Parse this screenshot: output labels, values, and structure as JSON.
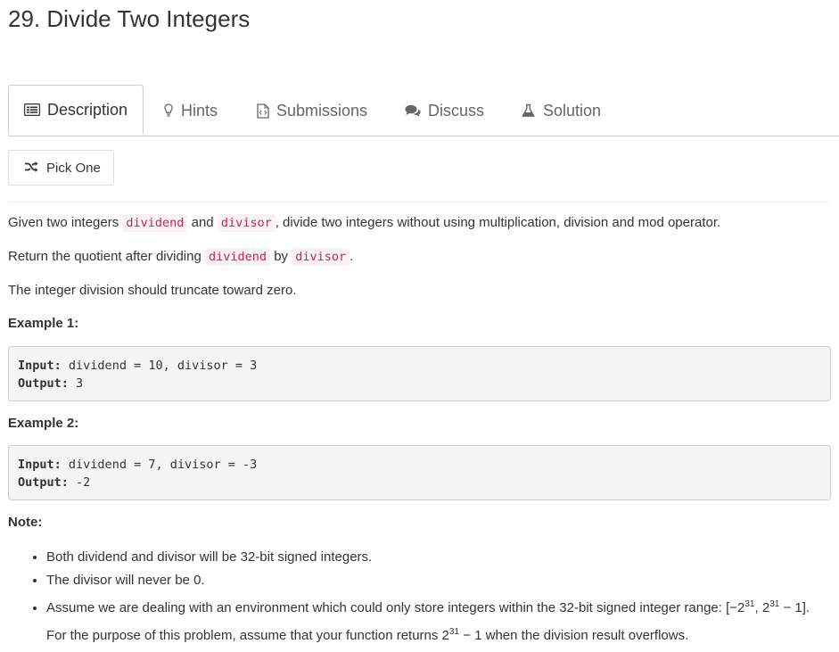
{
  "problem": {
    "title": "29. Divide Two Integers"
  },
  "tabs": [
    {
      "label": "Description",
      "icon": "description-icon",
      "active": true
    },
    {
      "label": "Hints",
      "icon": "lightbulb-icon",
      "active": false
    },
    {
      "label": "Submissions",
      "icon": "code-file-icon",
      "active": false
    },
    {
      "label": "Discuss",
      "icon": "comments-icon",
      "active": false
    },
    {
      "label": "Solution",
      "icon": "flask-icon",
      "active": false
    }
  ],
  "pick_one": {
    "label": "Pick One",
    "icon": "shuffle-icon"
  },
  "description": {
    "p1_a": "Given two integers",
    "p1_code1": "dividend",
    "p1_b": "and",
    "p1_code2": "divisor",
    "p1_c": ", divide two integers without using multiplication, division and mod operator.",
    "p2_a": "Return the quotient after dividing",
    "p2_code1": "dividend",
    "p2_b": "by",
    "p2_code2": "divisor",
    "p2_c": ".",
    "p3": "The integer division should truncate toward zero."
  },
  "examples": [
    {
      "heading": "Example 1:",
      "input_label": "Input:",
      "input_value": "dividend = 10, divisor = 3",
      "output_label": "Output:",
      "output_value": "3"
    },
    {
      "heading": "Example 2:",
      "input_label": "Input:",
      "input_value": "dividend = 7, divisor = -3",
      "output_label": "Output:",
      "output_value": "-2"
    }
  ],
  "note": {
    "heading": "Note:",
    "item1": "Both dividend and divisor will be 32-bit signed integers.",
    "item2": "The divisor will never be 0.",
    "item3_a": "Assume we are dealing with an environment which could only store integers within the 32-bit signed integer range: [−2",
    "item3_sup1": "31",
    "item3_b": ",  2",
    "item3_sup2": "31",
    "item3_c": " − 1]. For the purpose of this problem, assume that your function returns 2",
    "item3_sup3": "31",
    "item3_d": " − 1 when the division result overflows."
  }
}
